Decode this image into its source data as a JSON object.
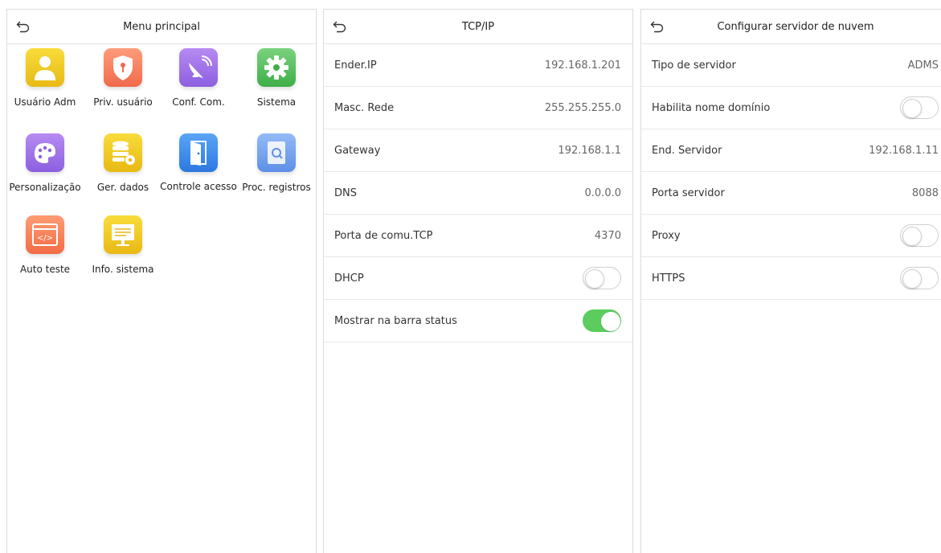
{
  "screens": {
    "main_menu": {
      "title": "Menu principal",
      "apps": [
        {
          "label": "Usuário Adm",
          "icon": "user-admin-icon"
        },
        {
          "label": "Priv. usuário",
          "icon": "shield-lock-icon"
        },
        {
          "label": "Conf. Com.",
          "icon": "satellite-dish-icon"
        },
        {
          "label": "Sistema",
          "icon": "gear-icon"
        },
        {
          "label": "Personalização",
          "icon": "palette-icon"
        },
        {
          "label": "Ger. dados",
          "icon": "database-gear-icon"
        },
        {
          "label": "Controle acesso",
          "icon": "door-icon"
        },
        {
          "label": "Proc. registros",
          "icon": "search-document-icon"
        },
        {
          "label": "Auto teste",
          "icon": "code-window-icon"
        },
        {
          "label": "Info. sistema",
          "icon": "monitor-icon"
        }
      ]
    },
    "tcpip": {
      "title": "TCP/IP",
      "rows": [
        {
          "label": "Ender.IP",
          "value": "192.168.1.201"
        },
        {
          "label": "Masc. Rede",
          "value": "255.255.255.0"
        },
        {
          "label": "Gateway",
          "value": "192.168.1.1"
        },
        {
          "label": "DNS",
          "value": "0.0.0.0"
        },
        {
          "label": "Porta de comu.TCP",
          "value": "4370"
        },
        {
          "label": "DHCP",
          "toggle": false
        },
        {
          "label": "Mostrar na barra status",
          "toggle": true
        }
      ]
    },
    "cloud": {
      "title": "Configurar servidor de nuvem",
      "rows": [
        {
          "label": "Tipo de servidor",
          "value": "ADMS"
        },
        {
          "label": "Habilita nome domínio",
          "toggle": false
        },
        {
          "label": "End. Servidor",
          "value": "192.168.1.11"
        },
        {
          "label": "Porta servidor",
          "value": "8088"
        },
        {
          "label": "Proxy",
          "toggle": false
        },
        {
          "label": "HTTPS",
          "toggle": false
        }
      ]
    }
  },
  "colors": {
    "toggle_on": "#5ccc5f",
    "divider": "#e8e8e8"
  }
}
